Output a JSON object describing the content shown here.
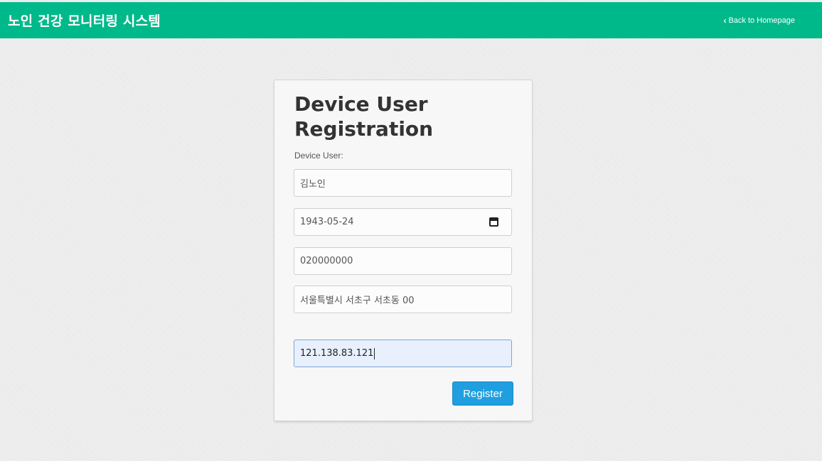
{
  "navbar": {
    "brand": "노인 건강 모니터링 시스템",
    "back_link": "Back to Homepage",
    "bg_color": "#00b98b"
  },
  "form": {
    "title": "Device User Registration",
    "label": "Device User:",
    "fields": [
      {
        "value": "김노인",
        "type": "text"
      },
      {
        "value": "1943-05-24",
        "type": "date",
        "icon": "calendar-icon"
      },
      {
        "value": "020000000",
        "type": "text"
      },
      {
        "value": "서울특별시 서초구 서초동 00",
        "type": "text"
      },
      {
        "value": "121.138.83.121",
        "type": "text",
        "focused": true
      }
    ],
    "submit_label": "Register",
    "button_color": "#1f9fdf"
  }
}
